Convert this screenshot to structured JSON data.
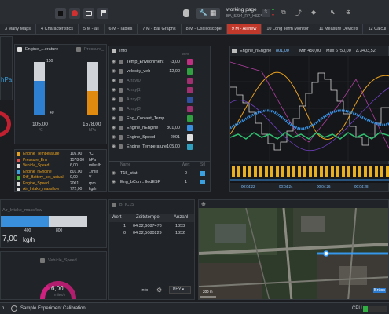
{
  "toolbar": {
    "page_label": "working page",
    "page_sub": "BA_5234_RP_HSE*",
    "page_num": "3"
  },
  "tabs": [
    "3 Many Maps",
    "4 Characteristics",
    "5 M - all",
    "6 M - Tables",
    "7 M - Bar Graphs",
    "8 M - Oscilloscope",
    "9 M - All new",
    "10 Long Term Monitor",
    "11 Measure Devices",
    "12 Calcul"
  ],
  "active_tab": 6,
  "left_top": {
    "unit": "hPa"
  },
  "bars": {
    "title1": "Engine_...erature",
    "title2": "Pressure_",
    "scale": [
      "150",
      "40"
    ],
    "val1": "105,00",
    "unit1": "°C",
    "val2": "1578,00",
    "unit2": "hPa",
    "fill1": 0.65,
    "fill2": 0.45
  },
  "sig_list": [
    {
      "name": "Engine_Temperature",
      "val": "105,00",
      "unit": "°C",
      "color": "#e6a020"
    },
    {
      "name": "Pressure_Env",
      "val": "1578,00",
      "unit": "hPa",
      "color": "#e05050"
    },
    {
      "name": "Vehicle_Speed",
      "val": "6,00",
      "unit": "miles/h",
      "color": "#dddddd"
    },
    {
      "name": "Engine_nEngine",
      "val": "801,00",
      "unit": "1/min",
      "color": "#3aa0e0"
    },
    {
      "name": "Diff_Battery_set_actual",
      "val": "0,00",
      "unit": "V",
      "color": "#4ac040"
    },
    {
      "name": "Engine_Speed",
      "val": "2001",
      "unit": "rpm",
      "color": "#dddddd"
    },
    {
      "name": "Air_Intake_massflow",
      "val": "772,00",
      "unit": "kg/h",
      "color": "#dddddd"
    }
  ],
  "massflow": {
    "title": "Air_Intake_massflow",
    "ticks": [
      "400",
      "800"
    ],
    "value": "7,00",
    "unit": "kg/h",
    "fill": 0.55
  },
  "gauge": {
    "title": "Vehicle_Speed",
    "value": "6,00",
    "unit": "miles/h"
  },
  "info_panel": {
    "title": "Info",
    "col_value": "Wert",
    "rows": [
      {
        "name": "Temp_Environment",
        "val": "-3,00",
        "color": "#c03080",
        "dim": false
      },
      {
        "name": "velocity_veh",
        "val": "12,00",
        "color": "#30a040",
        "dim": false
      },
      {
        "name": "Array[0]",
        "val": "",
        "color": "#a03070",
        "dim": true
      },
      {
        "name": "Array[1]",
        "val": "",
        "color": "#a03070",
        "dim": true
      },
      {
        "name": "Array[2]",
        "val": "",
        "color": "#3050a0",
        "dim": true
      },
      {
        "name": "Array[3]",
        "val": "",
        "color": "#a03070",
        "dim": true
      },
      {
        "name": "Eng_Coolant_Temp",
        "val": "",
        "color": "#30a040",
        "dim": false
      },
      {
        "name": "Engine_nEngine",
        "val": "801,00",
        "color": "#3a90e0",
        "dim": false
      },
      {
        "name": "Engine_Speed",
        "val": "2001",
        "color": "#e0e0e0",
        "dim": false
      },
      {
        "name": "Engine_Temperature",
        "val": "105,00",
        "color": "#30a0c0",
        "dim": false
      }
    ],
    "lower_header": {
      "name": "Name",
      "value": "Wert",
      "col3": "Stl"
    },
    "lower_rows": [
      {
        "name": "T15_stat",
        "val": "0"
      },
      {
        "name": "Eng_bCon...illedESP",
        "val": "1"
      }
    ]
  },
  "scope": {
    "signal": "Engine_nEngine",
    "value": "801,00",
    "min": "Min 450,00",
    "max": "Max 6750,00",
    "delta": "Δ 3403,52",
    "times": [
      "00:04:22",
      "00:04:24",
      "00:04:26",
      "00:04:28"
    ]
  },
  "table_panel": {
    "title": "B_IC15",
    "headers": [
      "Wert",
      "Zeitstempel",
      "Anzahl"
    ],
    "rows": [
      [
        "1",
        "04:32,6087478",
        "1353"
      ],
      [
        "0",
        "04:32,5080229",
        "1352"
      ]
    ],
    "footer_info": "Info",
    "footer_sel": "PHY"
  },
  "map": {
    "scale": "200 m",
    "place": "Brüss"
  },
  "statusbar": {
    "left": "n",
    "experiment": "Sample Experiment Calibration",
    "cpu": "CPU"
  }
}
